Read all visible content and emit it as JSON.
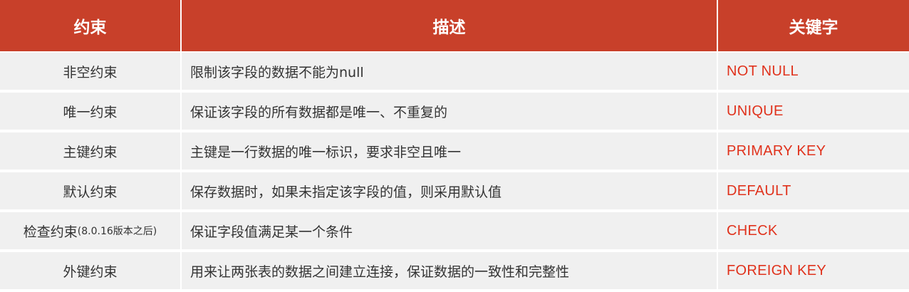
{
  "colors": {
    "header_bg": "#c8402a",
    "header_text": "#ffffff",
    "row_bg": "#f0f0f0",
    "keyword_text": "#e0321c",
    "body_text": "#333333"
  },
  "table": {
    "headers": [
      "约束",
      "描述",
      "关键字"
    ],
    "rows": [
      {
        "name": "非空约束",
        "note": "",
        "description": "限制该字段的数据不能为null",
        "keyword": "NOT  NULL"
      },
      {
        "name": "唯一约束",
        "note": "",
        "description": "保证该字段的所有数据都是唯一、不重复的",
        "keyword": "UNIQUE"
      },
      {
        "name": "主键约束",
        "note": "",
        "description": "主键是一行数据的唯一标识，要求非空且唯一",
        "keyword": "PRIMARY  KEY"
      },
      {
        "name": "默认约束",
        "note": "",
        "description": "保存数据时，如果未指定该字段的值，则采用默认值",
        "keyword": "DEFAULT"
      },
      {
        "name": "检查约束",
        "note": "(8.0.16版本之后)",
        "description": "保证字段值满足某一个条件",
        "keyword": "CHECK"
      },
      {
        "name": "外键约束",
        "note": "",
        "description": "用来让两张表的数据之间建立连接，保证数据的一致性和完整性",
        "keyword": "FOREIGN  KEY"
      }
    ]
  }
}
